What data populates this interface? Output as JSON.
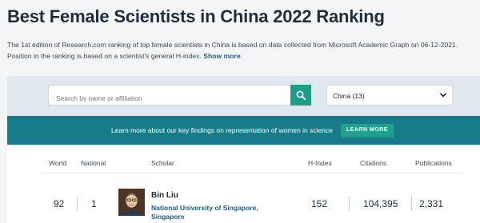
{
  "page": {
    "title": "Best Female Scientists in China 2022 Ranking",
    "description": "The 1st edition of Research.com ranking of top female scientists in China is based on data collected from Microsoft Academic Graph on 06-12-2021. Position in the ranking is based on a scientist's general H-index.",
    "show_more": "Show more"
  },
  "search": {
    "placeholder": "Search by name or affiliation",
    "country_selected": "China (13)"
  },
  "banner": {
    "text": "Learn more about our key findings on representation of women in science",
    "button": "LEARN MORE"
  },
  "table": {
    "headers": {
      "world": "World",
      "national": "National",
      "scholar": "Scholar",
      "hindex": "H-Index",
      "citations": "Citations",
      "publications": "Publications"
    },
    "rows": [
      {
        "world": "92",
        "national": "1",
        "name": "Bin Liu",
        "affiliation": "National University of Singapore, Singapore",
        "hindex": "152",
        "citations": "104,395",
        "publications": "2,331"
      }
    ]
  },
  "colors": {
    "accent": "#1e9e89",
    "banner": "#177b8a",
    "link": "#1b5f8f"
  },
  "icons": {
    "search": "search-icon",
    "dropdown": "chevron-down-icon"
  }
}
